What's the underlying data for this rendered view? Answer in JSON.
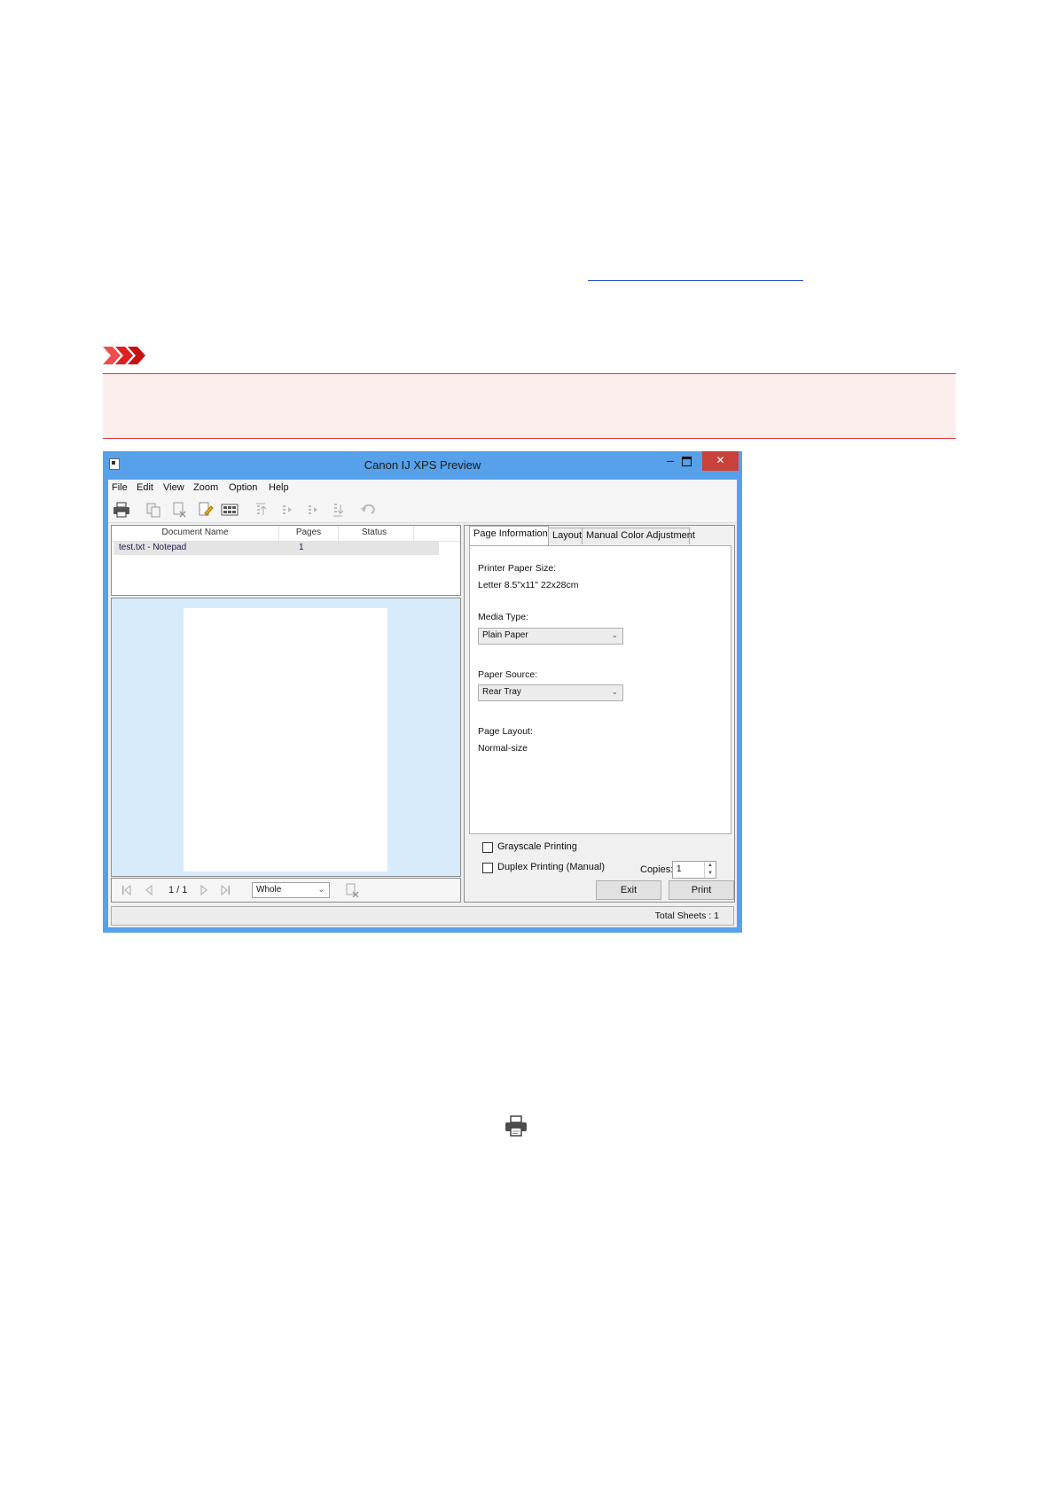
{
  "window": {
    "title": "Canon IJ XPS Preview",
    "minimize_glyph": "–",
    "close_glyph": "✕"
  },
  "menu": [
    {
      "label": "File"
    },
    {
      "label": "Edit"
    },
    {
      "label": "View"
    },
    {
      "label": "Zoom"
    },
    {
      "label": "Option"
    },
    {
      "label": "Help"
    }
  ],
  "toolbar": {
    "icons": [
      "print-icon",
      "copy-document-icon",
      "delete-document-icon",
      "edit-document-icon",
      "combine-pages-icon",
      "move-to-top-icon",
      "move-up-icon",
      "move-down-icon",
      "move-to-bottom-icon",
      "undo-icon"
    ]
  },
  "document_list": {
    "columns": [
      "Document Name",
      "Pages",
      "Status"
    ],
    "rows": [
      {
        "name": "test.txt - Notepad",
        "pages": "1",
        "status": ""
      }
    ]
  },
  "navigation": {
    "page_indicator": "1 / 1",
    "zoom_value": "Whole"
  },
  "settings": {
    "tabs": [
      "Page Information",
      "Layout",
      "Manual Color Adjustment"
    ],
    "active_tab": "Page Information",
    "printer_paper_size_label": "Printer Paper Size:",
    "printer_paper_size_value": "Letter 8.5\"x11\" 22x28cm",
    "media_type_label": "Media Type:",
    "media_type_value": "Plain Paper",
    "paper_source_label": "Paper Source:",
    "paper_source_value": "Rear Tray",
    "page_layout_label": "Page Layout:",
    "page_layout_value": "Normal-size",
    "grayscale_label": "Grayscale Printing",
    "grayscale_checked": false,
    "duplex_label": "Duplex Printing (Manual)",
    "duplex_checked": false,
    "copies_label": "Copies:",
    "copies_value": "1",
    "exit_label": "Exit",
    "print_label": "Print"
  },
  "status_bar": {
    "total_sheets": "Total Sheets : 1"
  },
  "colors": {
    "window_frame": "#56a1e9",
    "close_button": "#c7423a",
    "preview_background": "#d8ebfb",
    "important_red": "#d43a3a",
    "important_fill": "#fdeeee",
    "link_blue": "#2b4ecf"
  }
}
